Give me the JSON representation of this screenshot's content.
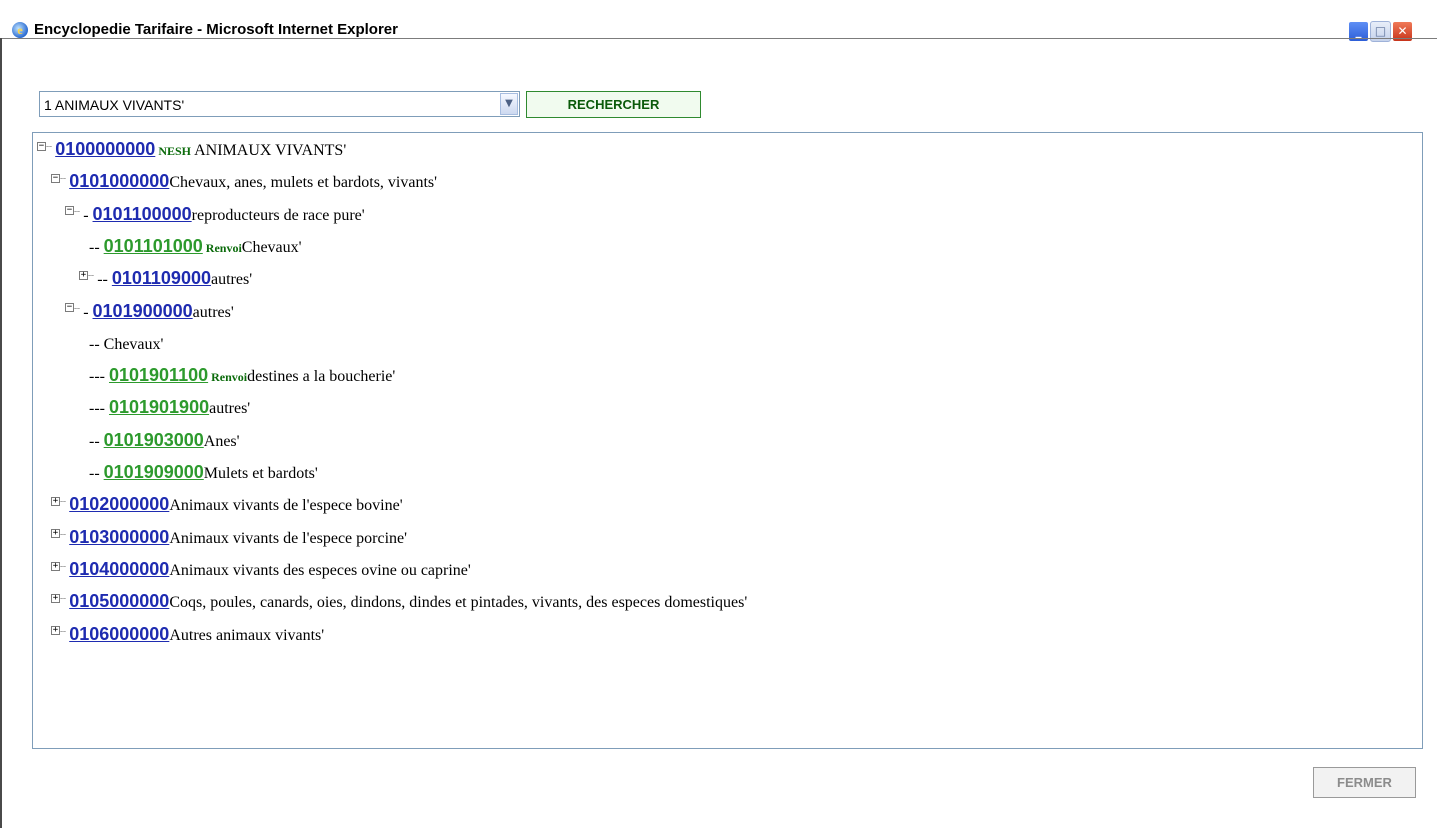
{
  "window": {
    "title": "Encyclopedie Tarifaire - Microsoft Internet Explorer",
    "app_icon": "ie-icon",
    "minimize_glyph": "_",
    "maximize_glyph": "□",
    "close_glyph": "✕"
  },
  "search": {
    "selected": "1 ANIMAUX VIVANTS'",
    "button_label": "RECHERCHER",
    "arrow": "▼"
  },
  "tree": {
    "rows": [
      {
        "toggle": "−",
        "prefix": "",
        "code": "0100000000",
        "tag": "NESH",
        "text": " ANIMAUX VIVANTS'"
      },
      {
        "toggle": "−",
        "prefix": "",
        "code": "0101000000",
        "tag": "",
        "text": "Chevaux, anes, mulets et bardots, vivants'"
      },
      {
        "toggle": "−",
        "prefix": "- ",
        "code": "0101100000",
        "tag": "",
        "text": "reproducteurs de race pure'"
      },
      {
        "toggle": "",
        "prefix": "-- ",
        "code": "0101101000",
        "tag": "Renvoi",
        "text": "Chevaux'"
      },
      {
        "toggle": "+",
        "prefix": "-- ",
        "code": "0101109000",
        "tag": "",
        "text": "autres'"
      },
      {
        "toggle": "−",
        "prefix": "- ",
        "code": "0101900000",
        "tag": "",
        "text": "autres'"
      },
      {
        "toggle": "",
        "prefix": "-- Chevaux'",
        "code": "",
        "tag": "",
        "text": ""
      },
      {
        "toggle": "",
        "prefix": "--- ",
        "code": "0101901100",
        "tag": "Renvoi",
        "text": "destines a la boucherie'"
      },
      {
        "toggle": "",
        "prefix": "--- ",
        "code": "0101901900",
        "tag": "",
        "text": "autres'"
      },
      {
        "toggle": "",
        "prefix": "-- ",
        "code": "0101903000",
        "tag": "",
        "text": "Anes'"
      },
      {
        "toggle": "",
        "prefix": "-- ",
        "code": "0101909000",
        "tag": "",
        "text": "Mulets et bardots'"
      },
      {
        "toggle": "+",
        "prefix": "",
        "code": "0102000000",
        "tag": "",
        "text": "Animaux vivants de l'espece bovine'"
      },
      {
        "toggle": "+",
        "prefix": "",
        "code": "0103000000",
        "tag": "",
        "text": "Animaux vivants de l'espece porcine'"
      },
      {
        "toggle": "+",
        "prefix": "",
        "code": "0104000000",
        "tag": "",
        "text": "Animaux vivants des especes ovine ou caprine'"
      },
      {
        "toggle": "+",
        "prefix": "",
        "code": "0105000000",
        "tag": "",
        "text": "Coqs, poules, canards, oies, dindons, dindes et pintades, vivants, des especes domestiques'"
      },
      {
        "toggle": "+",
        "prefix": "",
        "code": "0106000000",
        "tag": "",
        "text": "Autres animaux vivants'"
      }
    ]
  },
  "footer": {
    "close_label": "FERMER"
  },
  "colors": {
    "code_link_blue": "#1e2bb0",
    "code_leaf_green": "#2d9a2d",
    "tag_green": "#0b6b0b",
    "border": "#7f9db9"
  }
}
